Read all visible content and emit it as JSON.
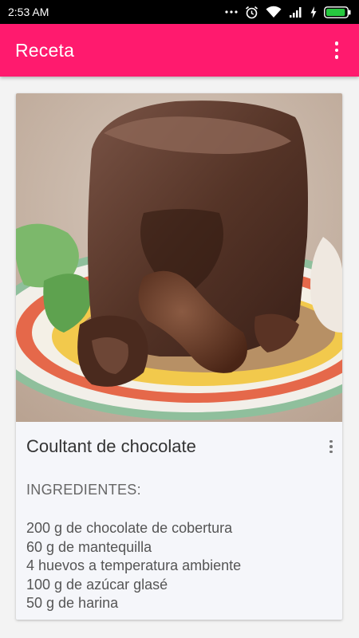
{
  "status_bar": {
    "time": "2:53 AM",
    "icons": [
      "signal-dots-icon",
      "alarm-icon",
      "wifi-icon",
      "cell-signal-icon",
      "charging-icon",
      "battery-icon"
    ],
    "battery_level": 0.9
  },
  "app_bar": {
    "title": "Receta",
    "menu_icon": "overflow-menu-icon",
    "color": "#ff1a6e"
  },
  "recipe": {
    "image": "chocolate-lava-cake-photo",
    "title": "Coultant de chocolate",
    "menu_icon": "card-overflow-icon",
    "ingredients_heading": "INGREDIENTES:",
    "ingredients": [
      "200 g de chocolate de cobertura",
      "60 g de mantequilla",
      "4 huevos a temperatura ambiente",
      "100 g de azúcar glasé",
      "50 g de harina"
    ]
  }
}
